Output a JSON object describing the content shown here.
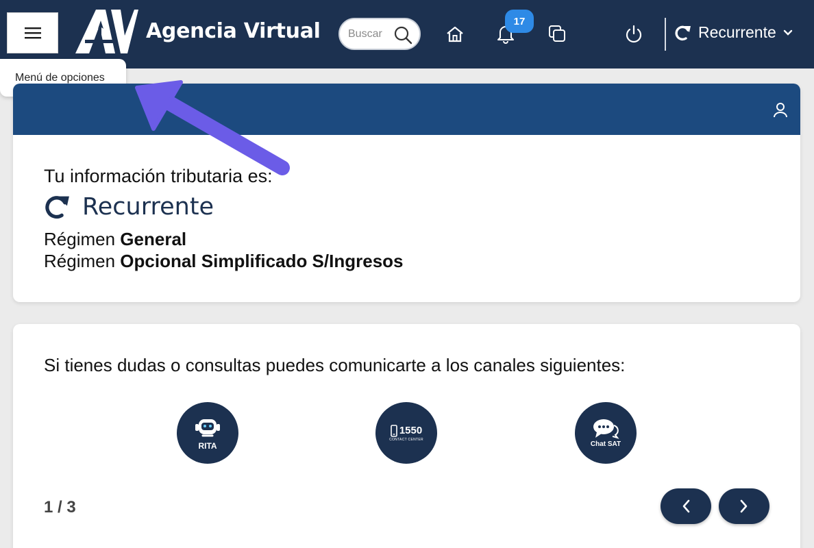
{
  "header": {
    "app_title": "Agencia Virtual",
    "search_placeholder": "Buscar",
    "notifications_count": "17",
    "profile_label": "Recurrente",
    "colors": {
      "bar": "#1c3150",
      "badge": "#2e8ae6"
    },
    "icons": [
      "hamburger-menu-icon",
      "search-icon",
      "home-icon",
      "bell-icon",
      "copy-windows-icon",
      "power-icon",
      "recurrent-arrow-icon",
      "chevron-down-icon"
    ]
  },
  "tooltip": {
    "text": "Menú de opciones"
  },
  "tax_card": {
    "intro": "Tu información tributaria es:",
    "status": "Recurrente",
    "regimes": [
      {
        "prefix": "Régimen",
        "name": "General"
      },
      {
        "prefix": "Régimen",
        "name": "Opcional Simplificado S/Ingresos"
      }
    ],
    "header_color": "#1c4a7f"
  },
  "contact_card": {
    "intro": "Si tienes dudas o consultas puedes comunicarte a los canales siguientes:",
    "channels": [
      {
        "label": "RITA",
        "icon": "rita-robot-icon"
      },
      {
        "label": "1550",
        "sublabel": "CONTACT CENTER",
        "icon": "phone-icon"
      },
      {
        "label": "Chat SAT",
        "icon": "chat-bubbles-icon"
      }
    ],
    "pager": "1 / 3"
  },
  "annotation": {
    "arrow_color": "#6b5ce7"
  }
}
